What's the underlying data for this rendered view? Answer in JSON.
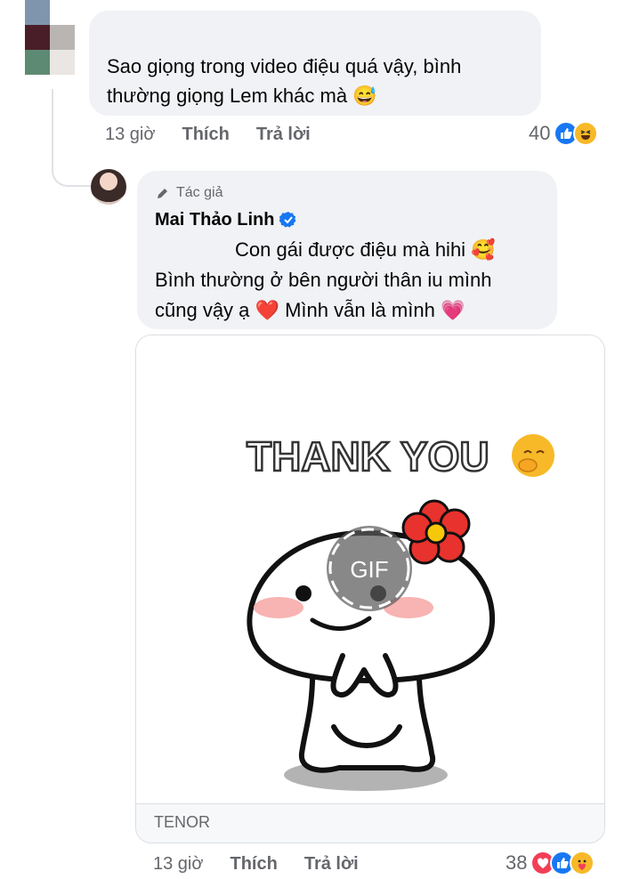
{
  "comment1": {
    "text": "Sao giọng trong video điệu quá vậy, bình thường giọng Lem khác mà",
    "emoji": "😅",
    "time": "13 giờ",
    "like_label": "Thích",
    "reply_label": "Trả lời",
    "reaction_count": "40",
    "reactions": [
      "like-icon",
      "haha-icon"
    ]
  },
  "comment2": {
    "author_tag": "Tác giả",
    "author_name": "Mai Thảo Linh",
    "line1": "Con gái được điệu mà hihi",
    "line1_emoji": "🥰",
    "line2": "Bình thường ở bên người thân iu mình",
    "line3": "cũng vậy ạ",
    "line3_emoji_a": "❤️",
    "line3_b": "Mình vẫn là mình",
    "line3_emoji_b": "💗",
    "time": "13 giờ",
    "like_label": "Thích",
    "reply_label": "Trả lời",
    "reaction_count": "38",
    "reactions": [
      "love-icon",
      "like-icon",
      "care-icon"
    ]
  },
  "gif": {
    "caption": "THANK YOU",
    "badge": "GIF",
    "source": "TENOR"
  },
  "colors": {
    "bubble": "#f0f2f5",
    "meta_text": "#65676b",
    "like_blue": "#1877f2",
    "love_red": "#f33e58",
    "haha_yellow": "#f7b928"
  }
}
